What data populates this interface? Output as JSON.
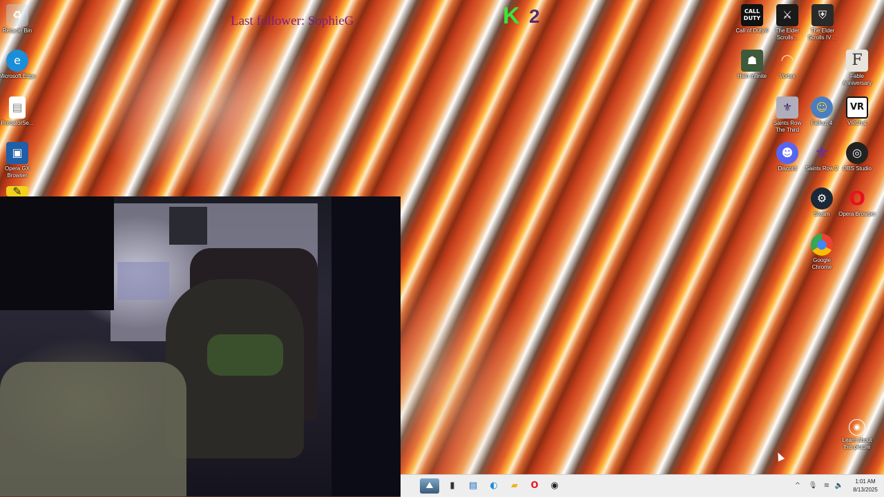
{
  "overlay": {
    "last_follower": "Last follower: SophieG",
    "kill_letter": "K",
    "kill_count": "2"
  },
  "desktop_icons_left": [
    {
      "label": "Recycle Bin",
      "icon": "recycle-bin-icon"
    },
    {
      "label": "Microsoft Edge",
      "icon": "edge-icon"
    },
    {
      "label": "PredatorSe...",
      "icon": "file-icon"
    },
    {
      "label": "Opera GX Browser",
      "icon": "opera-gx-icon"
    }
  ],
  "desktop_icons_right": [
    {
      "label": "Call of Duty®",
      "icon": "call-of-duty-icon"
    },
    {
      "label": "The Elder Scrolls...",
      "icon": "elder-scrolls-online-icon"
    },
    {
      "label": "The Elder Scrolls IV ...",
      "icon": "elder-scrolls-iv-icon"
    },
    {
      "label": "Halo Infinite",
      "icon": "halo-infinite-icon"
    },
    {
      "label": "Vortex",
      "icon": "vortex-icon"
    },
    {
      "label": "Fable Anniversary",
      "icon": "fable-icon"
    },
    {
      "label": "Saints Row The Third",
      "icon": "saints-row-third-icon"
    },
    {
      "label": "Fallout 4",
      "icon": "fallout-4-icon"
    },
    {
      "label": "VRChat",
      "icon": "vrchat-icon"
    },
    {
      "label": "Discord",
      "icon": "discord-icon"
    },
    {
      "label": "Saints Row 2",
      "icon": "saints-row-2-icon"
    },
    {
      "label": "OBS Studio",
      "icon": "obs-studio-icon"
    },
    {
      "label": "Steam",
      "icon": "steam-icon"
    },
    {
      "label": "Opera Browser",
      "icon": "opera-icon"
    },
    {
      "label": "Google Chrome",
      "icon": "chrome-icon"
    },
    {
      "label": "Learn about this picture",
      "icon": "learn-picture-icon"
    }
  ],
  "taskbar": {
    "pinned": [
      "landscape-widget-icon",
      "task-view-icon",
      "store-icon",
      "edge-icon",
      "file-explorer-icon",
      "opera-icon",
      "obs-studio-icon"
    ],
    "tray": [
      "chevron-up-icon",
      "microphone-icon",
      "network-icon",
      "speaker-icon"
    ],
    "time": "1:01 AM",
    "date": "8/13/2025"
  },
  "colors": {
    "taskbar_bg": "#eeeeee",
    "follower_text": "#7a1e7a",
    "kill_letter": "#3ee33a"
  }
}
